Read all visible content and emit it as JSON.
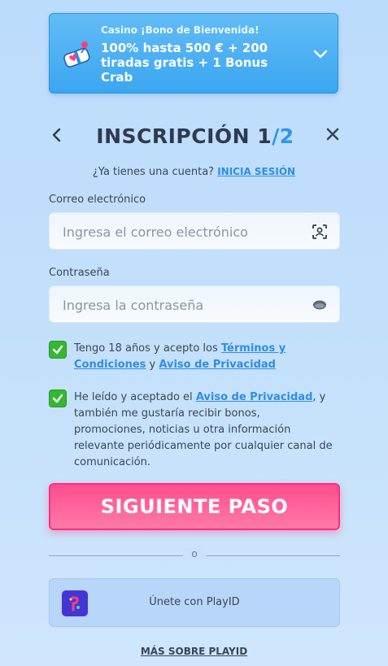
{
  "promo": {
    "subtitle": "Casino ¡Bono de Bienvenida!",
    "headline": "100% hasta 500 € + 200 tiradas gratis + 1 Bonus Crab"
  },
  "header": {
    "title": "INSCRIPCIÓN 1",
    "step": "/2"
  },
  "account": {
    "question": "¿Ya tienes una cuenta?",
    "login_link": "INICIA SESIÓN"
  },
  "form": {
    "email_label": "Correo electrónico",
    "email_placeholder": "Ingresa el correo electrónico",
    "password_label": "Contraseña",
    "password_placeholder": "Ingresa la contraseña"
  },
  "consents": {
    "age_text_1": "Tengo 18 años y acepto los",
    "terms_link": "Términos y Condiciones",
    "age_text_2": "y",
    "privacy_link": "Aviso de Privacidad",
    "marketing_text_1": "He leído y aceptado el",
    "marketing_privacy_link": "Aviso de Privacidad",
    "marketing_text_2": ", y también me gustaría recibir bonos, promociones, noticias u otra información relevante periódicamente por cualquier canal de comunicación."
  },
  "cta": {
    "label": "SIGUIENTE PASO"
  },
  "divider": {
    "label": "o"
  },
  "playid": {
    "label": "Únete con PlayID"
  },
  "more_link": "MÁS SOBRE PLAYID",
  "colors": {
    "accent_blue": "#2f8ee3",
    "cta_pink": "#ff2d7a",
    "check_green": "#35b732",
    "playid_purple": "#4436d6"
  }
}
